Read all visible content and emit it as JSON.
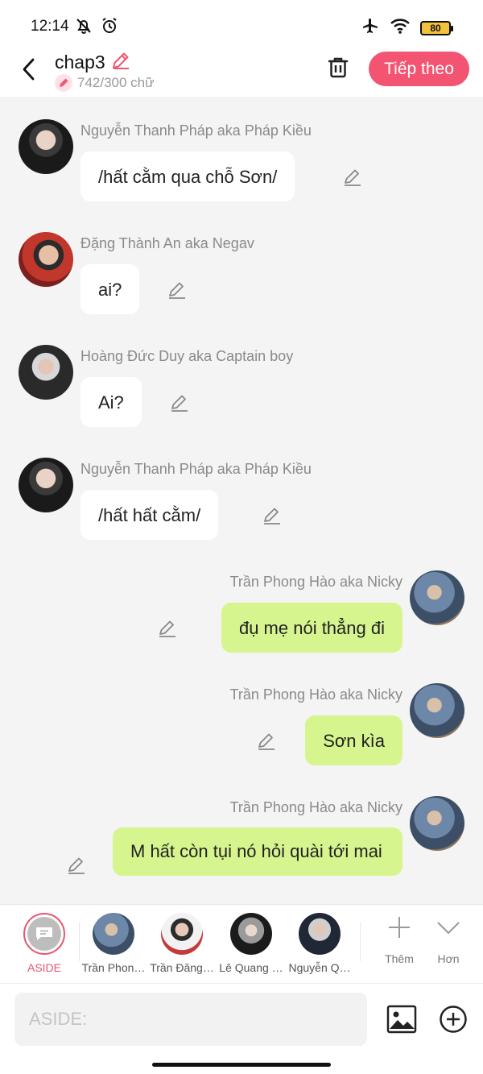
{
  "status": {
    "time": "12:14",
    "battery": "80"
  },
  "header": {
    "title": "chap3",
    "word_count": "742/300 chữ",
    "next_label": "Tiếp theo"
  },
  "colors": {
    "accent": "#f25472",
    "bubble_right": "#d7f58e",
    "bubble_left": "#ffffff"
  },
  "messages": [
    {
      "side": "left",
      "name": "Nguyễn Thanh Pháp aka Pháp Kiều",
      "text": "/hất cằm qua chỗ Sơn/"
    },
    {
      "side": "left",
      "name": "Đặng Thành An aka Negav",
      "text": "ai?"
    },
    {
      "side": "left",
      "name": "Hoàng Đức Duy aka Captain boy",
      "text": "Ai?"
    },
    {
      "side": "left",
      "name": "Nguyễn Thanh Pháp aka Pháp Kiều",
      "text": "/hất hất cằm/"
    },
    {
      "side": "right",
      "name": "Trần Phong Hào aka Nicky",
      "text": "đụ mẹ nói thẳng đi"
    },
    {
      "side": "right",
      "name": "Trần Phong Hào aka Nicky",
      "text": "Sơn kìa"
    },
    {
      "side": "right",
      "name": "Trần Phong Hào aka Nicky",
      "text": "M hất còn tụi nó hỏi quài tới mai"
    }
  ],
  "characters": {
    "aside": "ASIDE",
    "items": [
      "Trần Phon…",
      "Trần Đăng…",
      "Lê Quang …",
      "Nguyễn Q…"
    ],
    "more_label": "Thêm",
    "expand_label": "Hơn"
  },
  "input": {
    "placeholder": "ASIDE:"
  }
}
